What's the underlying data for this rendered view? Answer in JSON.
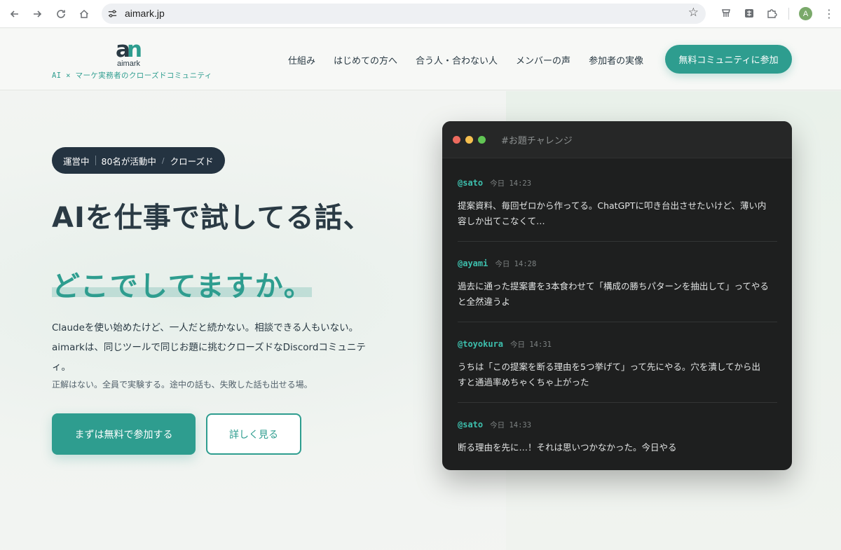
{
  "browser": {
    "url": "aimark.jp"
  },
  "header": {
    "logo_mark": "an",
    "logo_name": "aimark",
    "tagline": "AI × マーケ実務者のクローズドコミュニティ",
    "nav": [
      "仕組み",
      "はじめての方へ",
      "合う人・合わない人",
      "メンバーの声",
      "参加者の実像"
    ],
    "cta": "無料コミュニティに参加"
  },
  "hero": {
    "status": {
      "live": "運営中",
      "members": "80名が活動中",
      "sep": "/",
      "type": "クローズド"
    },
    "title_line1": "AIを仕事で試してる話、",
    "title_line2": "どこでしてますか。",
    "desc_lines": [
      "Claudeを使い始めたけど、一人だと続かない。相談できる人もいない。",
      "aimarkは、同じツールで同じお題に挑むクローズドなDiscordコミュニテ",
      "ィ。"
    ],
    "desc_small": "正解はない。全員で実験する。途中の話も、失敗した話も出せる場。",
    "btn_primary": "まずは無料で参加する",
    "btn_secondary": "詳しく見る"
  },
  "chat": {
    "channel": "#お題チャレンジ",
    "messages": [
      {
        "user": "@sato",
        "time": "今日 14:23",
        "lines": [
          "提案資料、毎回ゼロから作ってる。ChatGPTに叩き台出させたいけど、薄い内",
          "容しか出てこなくて…"
        ]
      },
      {
        "user": "@ayami",
        "time": "今日 14:28",
        "lines": [
          "過去に通った提案書を3本食わせて「構成の勝ちパターンを抽出して」ってやる",
          "と全然違うよ"
        ]
      },
      {
        "user": "@toyokura",
        "time": "今日 14:31",
        "lines": [
          "うちは「この提案を断る理由を5つ挙げて」って先にやる。穴を潰してから出",
          "すと通過率めちゃくちゃ上がった"
        ]
      },
      {
        "user": "@sato",
        "time": "今日 14:33",
        "lines": [
          "断る理由を先に…！それは思いつかなかった。今日やる"
        ]
      }
    ]
  },
  "colors": {
    "accent": "#2e9d8f",
    "dark": "#243341",
    "chat_bg": "#1e1f1f",
    "traffic_red": "#ed6a5e",
    "traffic_yellow": "#f5bf4f",
    "traffic_green": "#61c554"
  },
  "icons": {
    "back": "arrow-left-icon",
    "forward": "arrow-right-icon",
    "reload": "reload-icon",
    "home": "home-icon",
    "site_info": "tune-icon",
    "bookmark": "star-icon",
    "extensions": "puzzle-icon",
    "menu": "kebab-icon"
  },
  "profile_initial": "A"
}
